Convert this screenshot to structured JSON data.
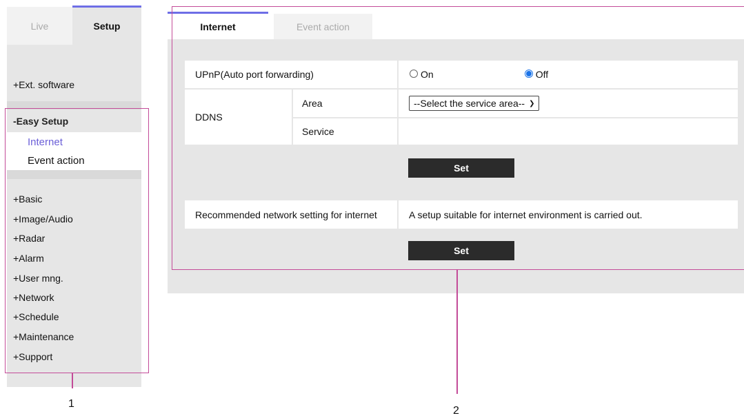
{
  "sidebar": {
    "tabs": [
      {
        "label": "Live"
      },
      {
        "label": "Setup"
      }
    ],
    "ext_software": "+Ext. software",
    "easy_setup": {
      "header": "-Easy Setup",
      "items": [
        {
          "label": "Internet"
        },
        {
          "label": "Event action"
        }
      ]
    },
    "menu": [
      {
        "label": "+Basic"
      },
      {
        "label": "+Image/Audio"
      },
      {
        "label": "+Radar"
      },
      {
        "label": "+Alarm"
      },
      {
        "label": "+User mng."
      },
      {
        "label": "+Network"
      },
      {
        "label": "+Schedule"
      },
      {
        "label": "+Maintenance"
      },
      {
        "label": "+Support"
      }
    ]
  },
  "main": {
    "tabs": [
      {
        "label": "Internet"
      },
      {
        "label": "Event action"
      }
    ],
    "upnp": {
      "label": "UPnP(Auto port forwarding)",
      "on": "On",
      "off": "Off",
      "selected": "Off"
    },
    "ddns": {
      "label": "DDNS",
      "area_label": "Area",
      "area_value": "--Select the service area--",
      "service_label": "Service"
    },
    "set_label": "Set",
    "recommended": {
      "label": "Recommended network setting for internet",
      "description": "A setup suitable for internet environment is carried out."
    }
  },
  "callouts": [
    {
      "number": "1"
    },
    {
      "number": "2"
    }
  ],
  "colors": {
    "accent": "#6e6ee6",
    "callout": "#c34b98",
    "button": "#2b2b2b",
    "panel": "#e6e6e6"
  }
}
